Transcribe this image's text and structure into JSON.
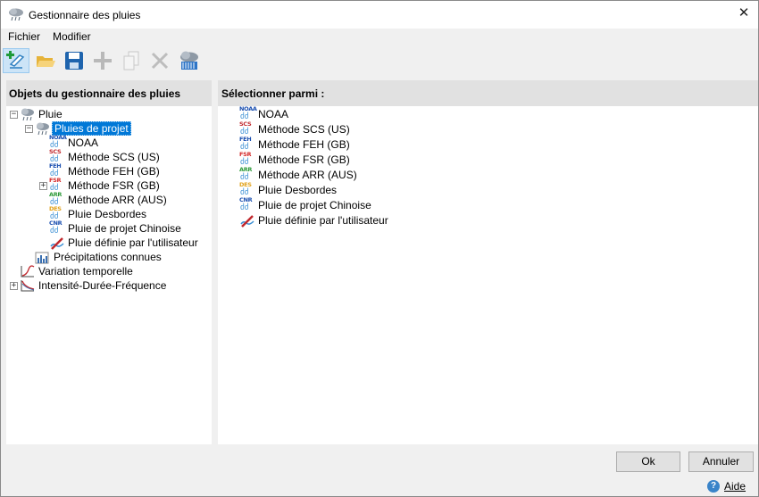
{
  "window": {
    "title": "Gestionnaire des pluies",
    "close_label": "✕"
  },
  "menu": {
    "file": "Fichier",
    "edit": "Modifier"
  },
  "toolbar": {
    "new": "new-icon",
    "open": "open-folder-icon",
    "save": "save-icon",
    "add": "add-icon",
    "copy": "copy-icon",
    "delete": "delete-icon",
    "manager": "rain-manager-icon"
  },
  "left_panel": {
    "header": "Objets du gestionnaire des pluies",
    "tree": {
      "pluie": "Pluie",
      "pluies_projet": "Pluies de projet",
      "noaa": "NOAA",
      "scs": "Méthode SCS (US)",
      "feh": "Méthode FEH (GB)",
      "fsr": "Méthode FSR (GB)",
      "arr": "Méthode ARR (AUS)",
      "desbordes": "Pluie Desbordes",
      "chinoise": "Pluie de projet Chinoise",
      "utilisateur": "Pluie définie par l'utilisateur",
      "precipitations": "Précipitations connues",
      "variation": "Variation temporelle",
      "idf": "Intensité-Durée-Fréquence"
    }
  },
  "right_panel": {
    "header": "Sélectionner parmi :",
    "items": [
      {
        "label": "NOAA",
        "code": "NOAA"
      },
      {
        "label": "Méthode SCS (US)",
        "code": "SCS"
      },
      {
        "label": "Méthode FEH (GB)",
        "code": "FEH"
      },
      {
        "label": "Méthode FSR (GB)",
        "code": "FSR"
      },
      {
        "label": "Méthode ARR (AUS)",
        "code": "ARR"
      },
      {
        "label": "Pluie Desbordes",
        "code": "DES"
      },
      {
        "label": "Pluie de projet Chinoise",
        "code": "CNR"
      },
      {
        "label": "Pluie définie par l'utilisateur",
        "code": ""
      }
    ]
  },
  "method_codes": {
    "noaa": "NOAA",
    "scs": "SCS",
    "feh": "FEH",
    "fsr": "FSR",
    "arr": "ARR",
    "des": "DES",
    "cnr": "CNR"
  },
  "colors": {
    "noaa": "#1a4fb0",
    "scs": "#c0282d",
    "feh": "#1a4fb0",
    "fsr": "#d42a2a",
    "arr": "#2e9a3a",
    "des": "#e2a21a",
    "cnr": "#1a4fb0",
    "selection": "#0078d7"
  },
  "buttons": {
    "ok": "Ok",
    "cancel": "Annuler"
  },
  "help": {
    "label": "Aide",
    "glyph": "?"
  }
}
